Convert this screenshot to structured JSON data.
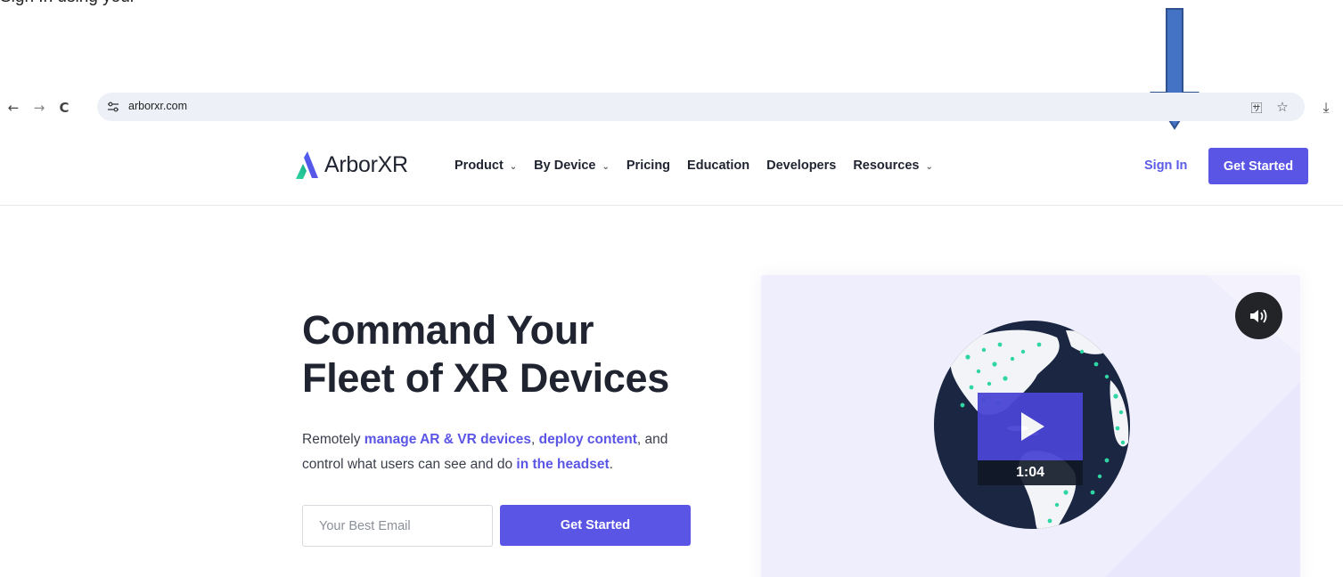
{
  "annotation": {
    "caption": "Sign In using your"
  },
  "browser": {
    "back_icon": "back-arrow-icon",
    "forward_icon": "forward-arrow-icon",
    "reload_icon": "reload-icon",
    "url": "arborxr.com",
    "back_glyph": "←",
    "forward_glyph": "→",
    "reload_glyph": "C",
    "translate_glyph": "🈂",
    "star_glyph": "☆",
    "download_glyph": "⤓"
  },
  "header": {
    "logo_text": "ArborXR",
    "nav": [
      {
        "label": "Product",
        "has_dropdown": true
      },
      {
        "label": "By Device",
        "has_dropdown": true
      },
      {
        "label": "Pricing",
        "has_dropdown": false
      },
      {
        "label": "Education",
        "has_dropdown": false
      },
      {
        "label": "Developers",
        "has_dropdown": false
      },
      {
        "label": "Resources",
        "has_dropdown": true
      }
    ],
    "sign_in": "Sign In",
    "get_started": "Get Started",
    "chevron_glyph": "⌄"
  },
  "hero": {
    "title_line1": "Command Your",
    "title_line2": "Fleet of XR Devices",
    "sub": {
      "p1": "Remotely ",
      "h1": "manage AR & VR devices",
      "p2": ", ",
      "h2": "deploy content",
      "p3": ", and control what users can see and do ",
      "h3": "in the headset",
      "p4": "."
    },
    "email_placeholder": "Your Best Email",
    "cta": "Get Started"
  },
  "video": {
    "duration": "1:04"
  },
  "colors": {
    "brand": "#5b55e6",
    "annotation_arrow": "#4472c4",
    "globe": "#1b2742",
    "dots": "#2fd6a3"
  }
}
